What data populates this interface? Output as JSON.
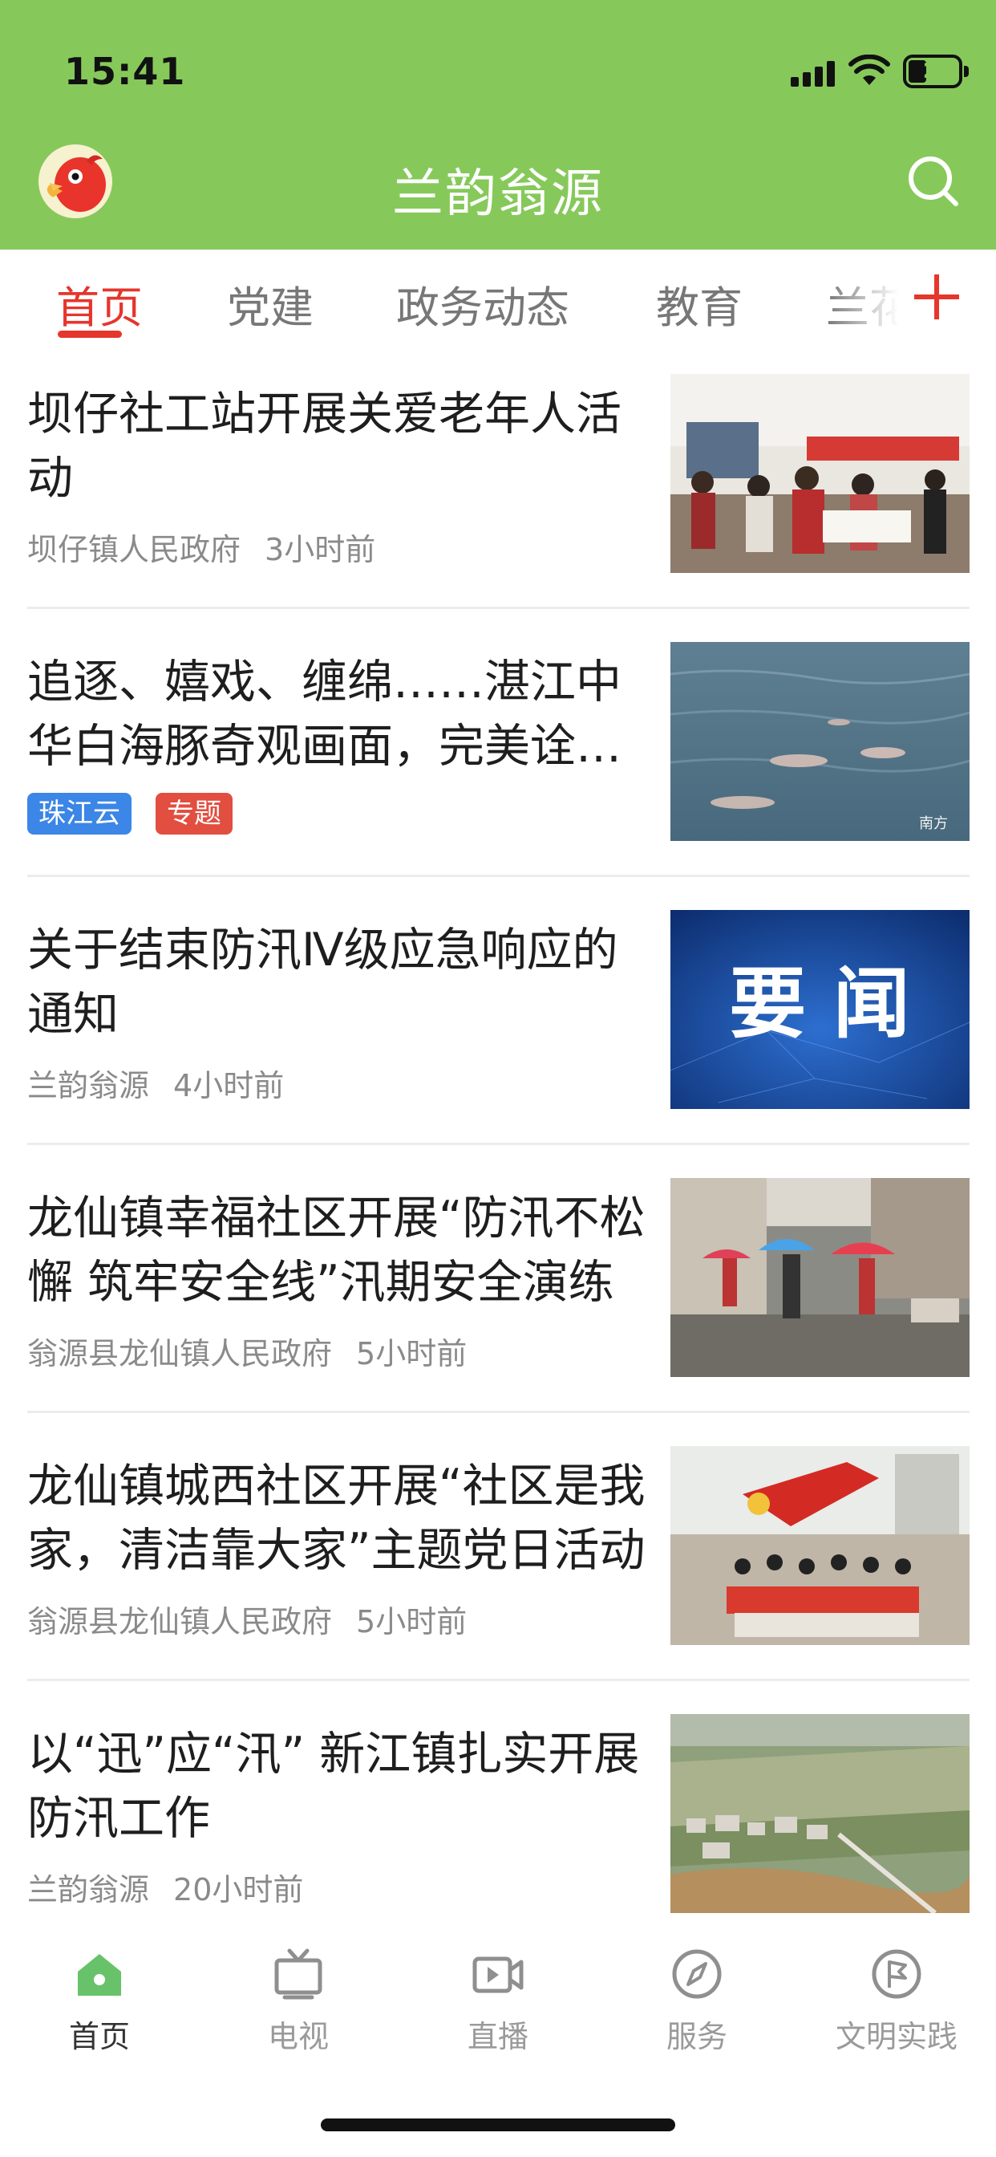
{
  "status_bar": {
    "time": "15:41",
    "battery": "21"
  },
  "header": {
    "title": "兰韵翁源",
    "avatar_icon": "parrot-avatar-icon",
    "search_icon": "search-icon"
  },
  "tabs": [
    {
      "label": "首页",
      "active": true
    },
    {
      "label": "党建",
      "active": false
    },
    {
      "label": "政务动态",
      "active": false
    },
    {
      "label": "教育",
      "active": false
    },
    {
      "label": "兰花",
      "active": false
    }
  ],
  "tab_add_icon": "plus-icon",
  "news": [
    {
      "title": "坝仔社工站开展关爱老年人活动",
      "source": "坝仔镇人民政府",
      "time": "3小时前",
      "tags": []
    },
    {
      "title": "追逐、嬉戏、缠绵……湛江中华白海豚奇观画面，完美诠释万物和谐共生",
      "source": "",
      "time": "",
      "tags": [
        "珠江云",
        "专题"
      ]
    },
    {
      "title": "关于结束防汛Ⅳ级应急响应的通知",
      "source": "兰韵翁源",
      "time": "4小时前",
      "tags": [],
      "thumb_text": "要 闻"
    },
    {
      "title": "龙仙镇幸福社区开展“防汛不松懈 筑牢安全线”汛期安全演练",
      "source": "翁源县龙仙镇人民政府",
      "time": "5小时前",
      "tags": []
    },
    {
      "title": "龙仙镇城西社区开展“社区是我家，清洁靠大家”主题党日活动",
      "source": "翁源县龙仙镇人民政府",
      "time": "5小时前",
      "tags": []
    },
    {
      "title": "以“迅”应“汛” 新江镇扎实开展防汛工作",
      "source": "兰韵翁源",
      "time": "20小时前",
      "tags": []
    }
  ],
  "bottom_tabs": [
    {
      "label": "首页",
      "icon": "home-icon",
      "active": true
    },
    {
      "label": "电视",
      "icon": "tv-icon",
      "active": false
    },
    {
      "label": "直播",
      "icon": "live-video-icon",
      "active": false
    },
    {
      "label": "服务",
      "icon": "compass-icon",
      "active": false
    },
    {
      "label": "文明实践",
      "icon": "flag-circle-icon",
      "active": false
    }
  ],
  "colors": {
    "header_green": "#86c95a",
    "accent_red": "#e5362c",
    "tag_blue": "#3b86e6",
    "tag_red": "#e24e3f",
    "tabbar_active_green": "#67c26a"
  }
}
